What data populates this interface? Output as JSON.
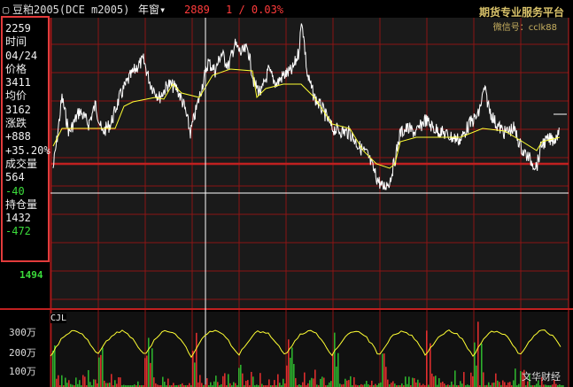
{
  "header": {
    "menu_icon": "▢",
    "ticker": "豆粕2005(DCE m2005)",
    "period": "年窗▾",
    "last_price": "2889",
    "change": "1 / 0.03%"
  },
  "watermark": {
    "line1": "期货专业服务平台",
    "line2": "微信号：cclk88"
  },
  "info_panel": {
    "price_value": "2259",
    "time_label": "时间",
    "date": "04/24",
    "price_label": "价格",
    "price": "3411",
    "avg_label": "均价",
    "avg": "3162",
    "change_label": "涨跌",
    "change": "+888",
    "change_pct": "+35.20%",
    "volume_label": "成交量",
    "volume": "564",
    "volume_change": "-40",
    "oi_label": "持仓量",
    "oi": "1432",
    "oi_change": "-472"
  },
  "axis": {
    "lower_price": "1494"
  },
  "volume_panel": {
    "label": "CJL",
    "ticks": [
      "300万",
      "200万",
      "100万"
    ]
  },
  "brand": "文华财经",
  "colors": {
    "grid": "#8b1414",
    "price_line": "#ffffff",
    "avg_line": "#ffff33",
    "crosshair": "#ffffff",
    "highlight": "#e23b3b",
    "vol_up": "#ff3333",
    "vol_down": "#33cc33"
  }
}
